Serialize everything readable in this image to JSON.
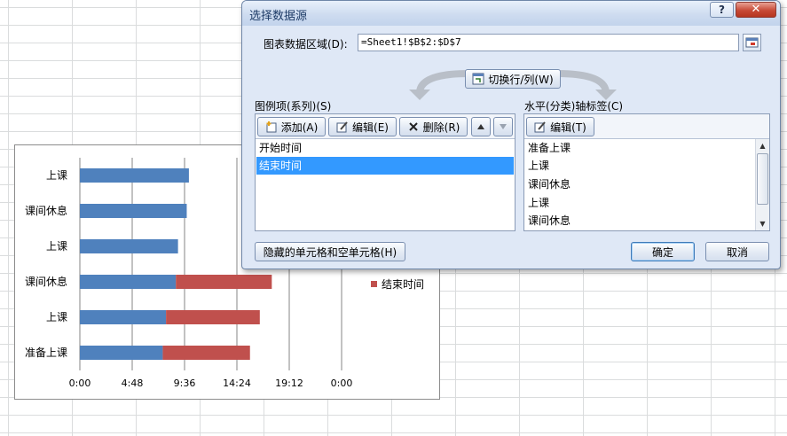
{
  "dialog": {
    "title": "选择数据源",
    "help_label": "?",
    "close_label": "✕",
    "range_label": "图表数据区域(D):",
    "range_value": "=Sheet1!$B$2:$D$7",
    "switch_label": "切换行/列(W)",
    "legend_section_label": "图例项(系列)(S)",
    "axis_section_label": "水平(分类)轴标签(C)",
    "add_label": "添加(A)",
    "edit_label": "编辑(E)",
    "delete_label": "删除(R)",
    "axis_edit_label": "编辑(T)",
    "series": [
      "开始时间",
      "结束时间"
    ],
    "selected_series": 1,
    "axis_labels": [
      "准备上课",
      "上课",
      "课间休息",
      "上课",
      "课间休息"
    ],
    "hidden_cells_label": "隐藏的单元格和空单元格(H)",
    "ok_label": "确定",
    "cancel_label": "取消"
  },
  "chart_data": {
    "type": "bar",
    "orientation": "horizontal",
    "stacked": true,
    "categories": [
      "上课",
      "课间休息",
      "上课",
      "课间休息",
      "上课",
      "准备上课"
    ],
    "series": [
      {
        "name": "开始时间",
        "color": "#4f81bd",
        "values": [
          10.0,
          9.8,
          9.0,
          8.8,
          7.9,
          7.6
        ]
      },
      {
        "name": "结束时间",
        "color": "#c0504d",
        "values": [
          null,
          null,
          null,
          8.8,
          8.6,
          8.0
        ]
      }
    ],
    "x_ticks": [
      "0:00",
      "4:48",
      "9:36",
      "14:24",
      "19:12",
      "0:00"
    ],
    "xlim": [
      0,
      24
    ],
    "grid": true,
    "legend_visible": [
      "结束时间"
    ],
    "legend_position": "right"
  }
}
